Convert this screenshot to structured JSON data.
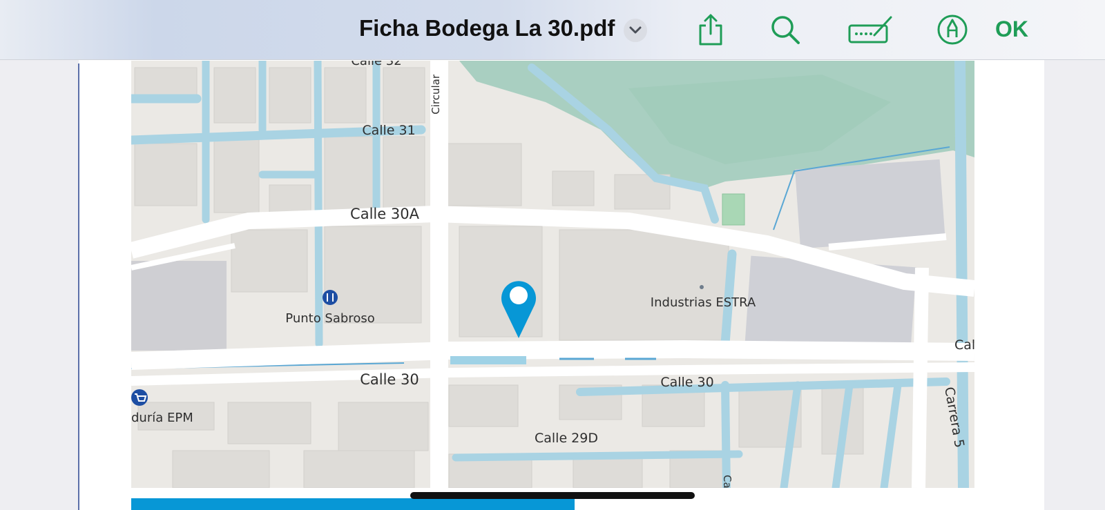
{
  "toolbar": {
    "title": "Ficha Bodega La 30.pdf",
    "ok_label": "OK",
    "accent_color": "#1f9d57",
    "icons": [
      "share-icon",
      "search-icon",
      "signature-icon",
      "markup-pen-icon",
      "chevron-down-icon"
    ]
  },
  "map": {
    "pin_color": "#0797d6",
    "street_labels": {
      "calle_32": "Calle 32",
      "circular": "Circular",
      "calle_31": "Calle 31",
      "calle_30a": "Calle 30A",
      "calle_30_left": "Calle 30",
      "calle_30_right": "Calle 30",
      "calle_29d": "Calle 29D",
      "carrera": "Carrera 5",
      "cal_right": "Cal",
      "ca_bottom": "Ca"
    },
    "places": {
      "punto_sabroso": "Punto Sabroso",
      "industrias_estra": "Industrias ESTRA",
      "epm": "duría EPM"
    }
  }
}
